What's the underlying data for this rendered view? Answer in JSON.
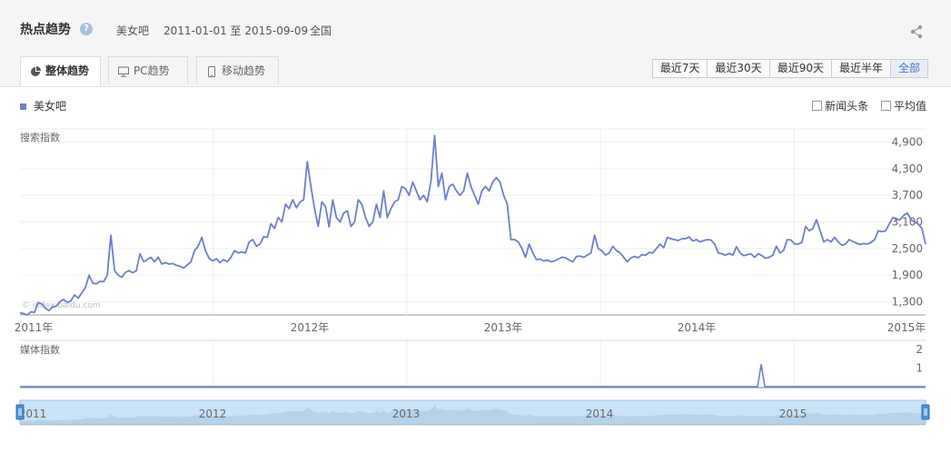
{
  "header": {
    "title": "热点趋势",
    "help_icon": "question-icon",
    "keyword": "美女吧",
    "date_range": "2011-01-01 至 2015-09-09",
    "region": "全国",
    "share_icon": "share-icon"
  },
  "tabs": [
    {
      "label": "整体趋势",
      "icon": "pie-chart-icon",
      "active": true
    },
    {
      "label": "PC趋势",
      "icon": "monitor-icon",
      "active": false
    },
    {
      "label": "移动趋势",
      "icon": "mobile-icon",
      "active": false
    }
  ],
  "range_buttons": [
    {
      "label": "最近7天",
      "selected": false
    },
    {
      "label": "最近30天",
      "selected": false
    },
    {
      "label": "最近90天",
      "selected": false
    },
    {
      "label": "最近半年",
      "selected": false
    },
    {
      "label": "全部",
      "selected": true
    }
  ],
  "legend": {
    "series_name": "美女吧",
    "color": "#6d7fcc"
  },
  "options": {
    "headline_label": "新闻头条",
    "average_label": "平均值"
  },
  "watermark": "© index.baidu.com",
  "colors": {
    "line": "#6d7fcc",
    "navigator_fill": "#c8e3f5",
    "handle": "#4a90d9"
  },
  "chart_data": [
    {
      "type": "line",
      "panel": "search",
      "ylabel": "搜索指数",
      "x_unit": "week",
      "x_start": "2011-01-01",
      "x_end": "2015-09-09",
      "ylim": [
        1000,
        5200
      ],
      "yticks": [
        1300,
        1900,
        2500,
        3100,
        3700,
        4300,
        4900
      ],
      "ytick_labels": [
        "1,300",
        "1,900",
        "2,500",
        "3,100",
        "3,700",
        "4,300",
        "4,900"
      ],
      "xticks": [
        "2011年",
        "2012年",
        "2013年",
        "2014年",
        "2015年"
      ],
      "series": [
        {
          "name": "美女吧",
          "values": [
            1050,
            1030,
            1000,
            1070,
            1060,
            1280,
            1250,
            1150,
            1100,
            1180,
            1200,
            1300,
            1350,
            1280,
            1320,
            1450,
            1380,
            1500,
            1620,
            1900,
            1720,
            1700,
            1760,
            1750,
            1900,
            2800,
            2000,
            1900,
            1850,
            1960,
            2000,
            1950,
            2000,
            2380,
            2200,
            2250,
            2300,
            2200,
            2300,
            2150,
            2180,
            2150,
            2160,
            2120,
            2100,
            2060,
            2130,
            2200,
            2450,
            2550,
            2750,
            2450,
            2280,
            2220,
            2270,
            2180,
            2250,
            2200,
            2300,
            2450,
            2400,
            2420,
            2400,
            2650,
            2700,
            2550,
            2600,
            2770,
            2750,
            3060,
            2950,
            3200,
            3100,
            3500,
            3400,
            3600,
            3420,
            3550,
            3600,
            4460,
            3900,
            3400,
            3000,
            3550,
            3450,
            2990,
            3600,
            3200,
            3100,
            3300,
            3350,
            3000,
            3100,
            3600,
            3500,
            3200,
            3000,
            3100,
            3500,
            3200,
            3800,
            3200,
            3400,
            3550,
            3600,
            3900,
            3850,
            3700,
            4000,
            3800,
            3600,
            3700,
            3550,
            4030,
            5050,
            3900,
            4200,
            3600,
            3900,
            3950,
            3800,
            3700,
            3800,
            4200,
            3900,
            3700,
            3500,
            3800,
            3900,
            3800,
            4000,
            4100,
            4000,
            3700,
            3500,
            2700,
            2700,
            2650,
            2500,
            2300,
            2600,
            2400,
            2250,
            2260,
            2220,
            2240,
            2200,
            2220,
            2260,
            2300,
            2290,
            2240,
            2200,
            2320,
            2330,
            2300,
            2350,
            2400,
            2800,
            2500,
            2450,
            2350,
            2400,
            2550,
            2450,
            2400,
            2300,
            2200,
            2290,
            2320,
            2290,
            2360,
            2350,
            2410,
            2400,
            2500,
            2600,
            2520,
            2750,
            2720,
            2700,
            2680,
            2720,
            2720,
            2760,
            2670,
            2700,
            2650,
            2680,
            2700,
            2690,
            2600,
            2400,
            2380,
            2350,
            2390,
            2350,
            2540,
            2400,
            2340,
            2360,
            2380,
            2300,
            2380,
            2340,
            2280,
            2300,
            2350,
            2550,
            2400,
            2460,
            2700,
            2690,
            2600,
            2600,
            2640,
            3000,
            2900,
            2950,
            3150,
            2900,
            2650,
            2700,
            2650,
            2750,
            2650,
            2570,
            2600,
            2700,
            2660,
            2620,
            2590,
            2610,
            2600,
            2640,
            2700,
            2900,
            2880,
            2900,
            3050,
            3200,
            3150,
            3150,
            3250,
            3300,
            3150,
            3100,
            3050,
            2950,
            2600
          ]
        }
      ]
    },
    {
      "type": "line",
      "panel": "media",
      "ylabel": "媒体指数",
      "ylim": [
        0,
        2
      ],
      "yticks": [
        1,
        2
      ],
      "ytick_labels": [
        "1",
        "2"
      ],
      "series": [
        {
          "name": "",
          "spike_position": 0.8185,
          "spike_value": 1.2,
          "baseline": 0
        }
      ]
    },
    {
      "type": "area",
      "panel": "navigator",
      "xticks": [
        "2011",
        "2012",
        "2013",
        "2014",
        "2015"
      ]
    }
  ]
}
